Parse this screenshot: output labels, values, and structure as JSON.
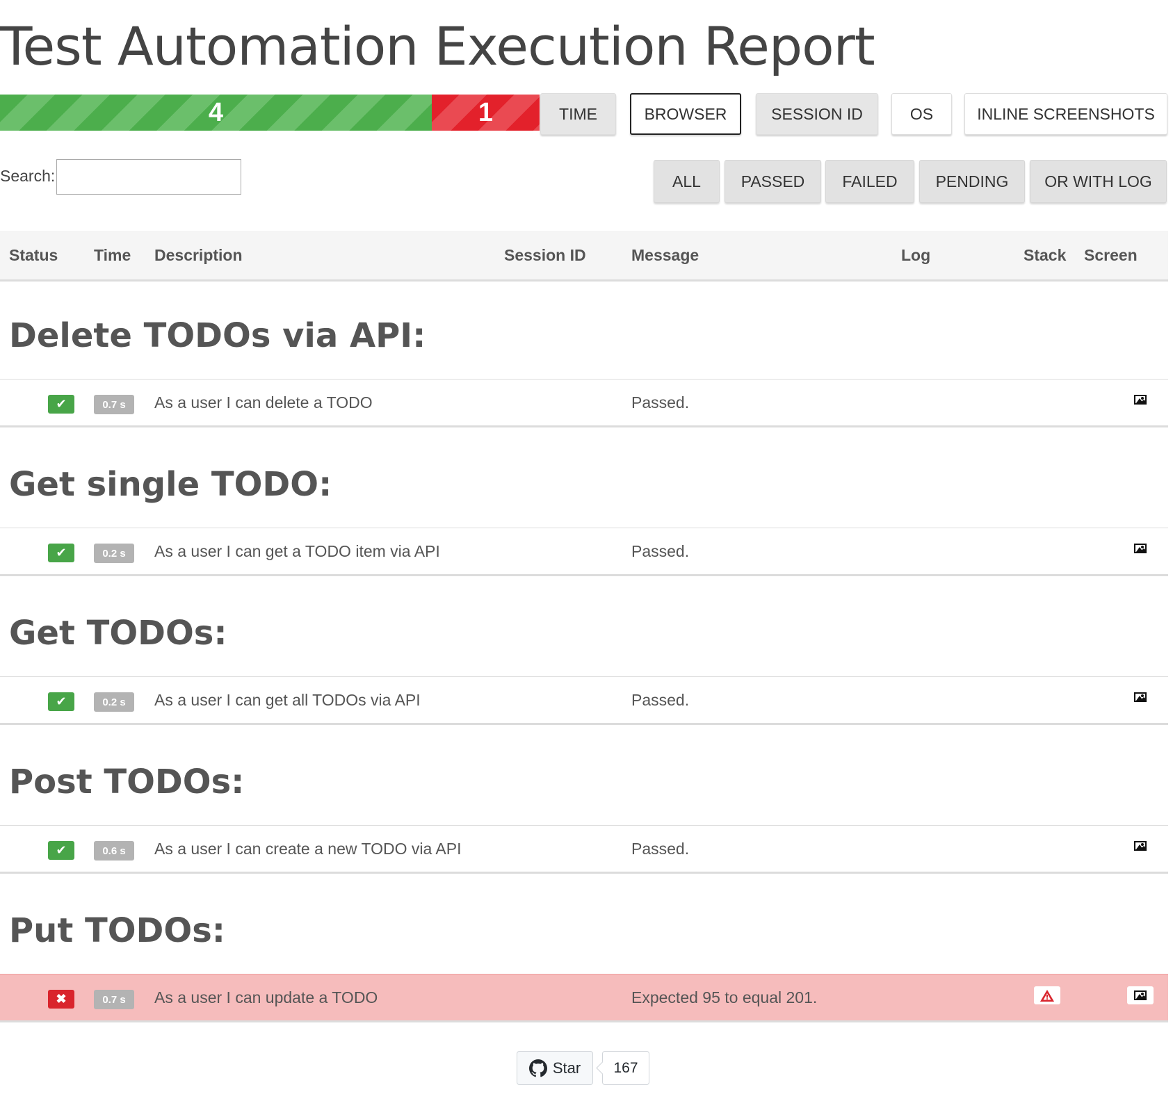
{
  "title": "Test Automation Execution Report",
  "summary": {
    "passed": 4,
    "failed": 1,
    "passed_label": "4",
    "failed_label": "1"
  },
  "column_toggles": [
    "TIME",
    "BROWSER",
    "SESSION ID",
    "OS",
    "INLINE SCREENSHOTS"
  ],
  "search": {
    "label": "Search:",
    "value": "",
    "placeholder": ""
  },
  "filters": [
    "ALL",
    "PASSED",
    "FAILED",
    "PENDING",
    "OR WITH LOG"
  ],
  "table": {
    "headers": [
      "Status",
      "Time",
      "Description",
      "Session ID",
      "Message",
      "Log",
      "Stack",
      "Screen"
    ]
  },
  "groups": [
    {
      "title": "Delete TODOs via API:",
      "rows": [
        {
          "status": "passed",
          "time": "0.7 s",
          "description": "As a user I can delete a TODO",
          "message": "Passed."
        }
      ]
    },
    {
      "title": "Get single TODO:",
      "rows": [
        {
          "status": "passed",
          "time": "0.2 s",
          "description": "As a user I can get a TODO item via API",
          "message": "Passed."
        }
      ]
    },
    {
      "title": "Get TODOs:",
      "rows": [
        {
          "status": "passed",
          "time": "0.2 s",
          "description": "As a user I can get all TODOs via API",
          "message": "Passed."
        }
      ]
    },
    {
      "title": "Post TODOs:",
      "rows": [
        {
          "status": "passed",
          "time": "0.6 s",
          "description": "As a user I can create a new TODO via API",
          "message": "Passed."
        }
      ]
    },
    {
      "title": "Put TODOs:",
      "rows": [
        {
          "status": "failed",
          "time": "0.7 s",
          "description": "As a user I can update a TODO",
          "message": "Expected 95 to equal 201."
        }
      ]
    }
  ],
  "icons": {
    "pass": "checkmark-icon",
    "fail": "x-icon",
    "screen": "image-icon",
    "stack": "warning-icon",
    "github": "github-icon"
  },
  "colors": {
    "pass": "#48a548",
    "fail": "#d9242c",
    "failed_row": "#f6bcbc"
  },
  "github": {
    "star_label": "Star",
    "count": "167"
  }
}
